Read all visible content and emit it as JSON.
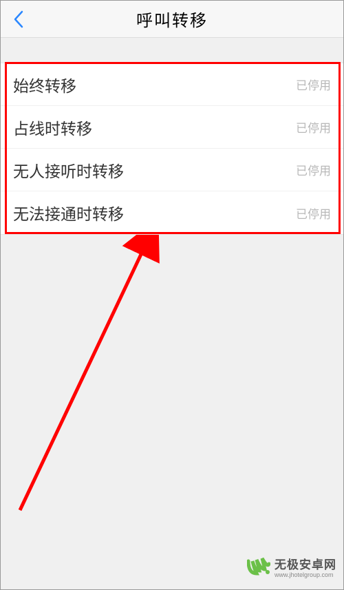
{
  "header": {
    "title": "呼叫转移"
  },
  "list": {
    "items": [
      {
        "label": "始终转移",
        "status": "已停用"
      },
      {
        "label": "占线时转移",
        "status": "已停用"
      },
      {
        "label": "无人接听时转移",
        "status": "已停用"
      },
      {
        "label": "无法接通时转移",
        "status": "已停用"
      }
    ]
  },
  "watermark": {
    "line1": "无极安卓网",
    "line2": "www.jhotelgroup.com"
  },
  "colors": {
    "accent_back": "#2a87ff",
    "annot": "#ff0000",
    "logo_green": "#6bc048"
  }
}
